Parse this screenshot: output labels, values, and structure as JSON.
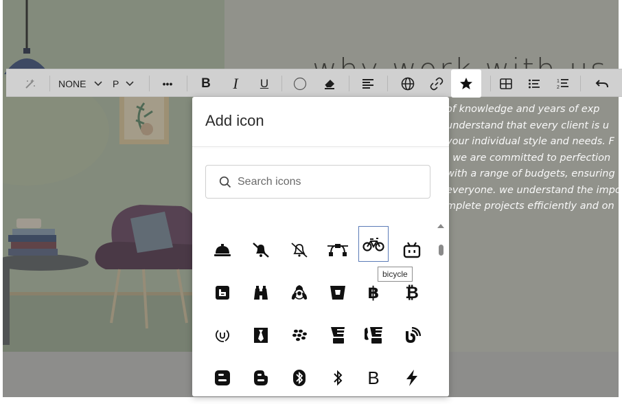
{
  "page": {
    "heading": "why work with us",
    "paragraph_lines": [
      "of knowledge and years of exp",
      "understand that every client is u",
      "your individual style and needs. F",
      ". we are committed to perfection",
      "with a range of budgets, ensuring",
      "everyone. we understand the impor",
      "mplete projects efficiently and on"
    ]
  },
  "toolbar": {
    "style_select": "NONE",
    "paragraph_select": "P",
    "more_label": "•••",
    "bold": "B",
    "italic": "I",
    "underline": "U",
    "active_tool": "insert-icon",
    "buttons": [
      "magic-wand-icon",
      "more-icon",
      "bold-icon",
      "italic-icon",
      "underline-icon",
      "circle-color-icon",
      "eraser-icon",
      "align-icon",
      "globe-icon",
      "link-icon",
      "star-icon",
      "table-icon",
      "bullet-list-icon",
      "numbered-list-icon",
      "undo-icon"
    ]
  },
  "modal": {
    "title": "Add icon",
    "search_placeholder": "Search icons",
    "tooltip": "bicycle",
    "selected_icon": "bicycle",
    "icons": [
      [
        "concierge-bell",
        "bell-slash",
        "bell-slash-outline",
        "bezier-curve",
        "bicycle",
        "bilibili"
      ],
      [
        "bimobject",
        "binoculars",
        "biohazard",
        "bitbucket",
        "bitcoin-sign",
        "btc"
      ],
      [
        "bity",
        "black-tie",
        "blackberry",
        "blender",
        "blender-phone",
        "blog"
      ],
      [
        "blogger",
        "blogger-b",
        "bluetooth",
        "bluetooth-b",
        "bold",
        "bolt"
      ]
    ],
    "letter_glyphs": {
      "bitcoin-sign": "฿",
      "btc": "₿",
      "bold": "B"
    }
  },
  "colors": {
    "accent_selection": "#5b7bb7",
    "toolbar_bg": "#d0d0d0",
    "modal_bg": "#ffffff"
  }
}
